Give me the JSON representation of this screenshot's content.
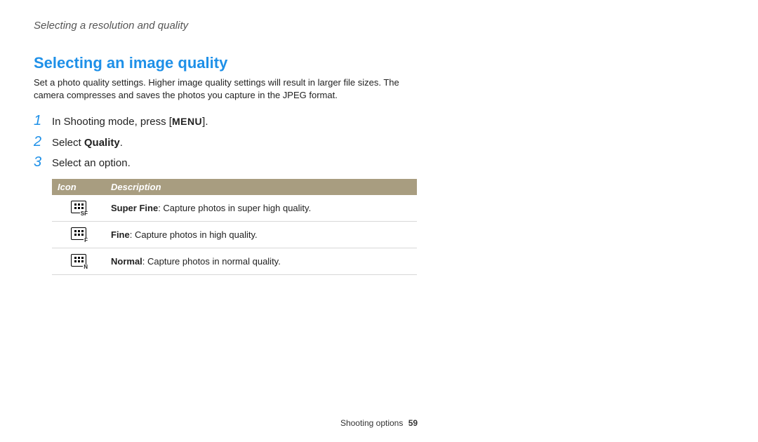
{
  "breadcrumb": "Selecting a resolution and quality",
  "heading": "Selecting an image quality",
  "intro": "Set a photo quality settings. Higher image quality settings will result in larger file sizes. The camera compresses and saves the photos you capture in the JPEG format.",
  "steps": {
    "s1_num": "1",
    "s1_pre": "In Shooting mode, press [",
    "s1_menu": "MENU",
    "s1_post": "].",
    "s2_num": "2",
    "s2_pre": "Select ",
    "s2_bold": "Quality",
    "s2_post": ".",
    "s3_num": "3",
    "s3_text": "Select an option."
  },
  "table": {
    "h_icon": "Icon",
    "h_desc": "Description",
    "rows": [
      {
        "icon_sub": "SF",
        "label": "Super Fine",
        "desc": ": Capture photos in super high quality."
      },
      {
        "icon_sub": "F",
        "label": "Fine",
        "desc": ": Capture photos in high quality."
      },
      {
        "icon_sub": "N",
        "label": "Normal",
        "desc": ": Capture photos in normal quality."
      }
    ]
  },
  "footer": {
    "section": "Shooting options",
    "page": "59"
  }
}
